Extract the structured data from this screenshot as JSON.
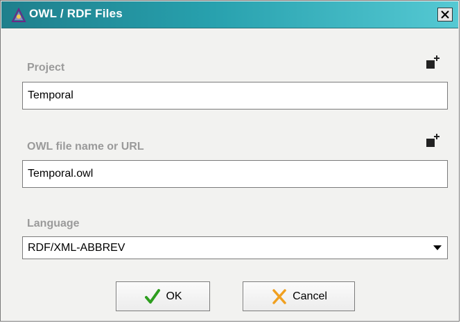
{
  "window": {
    "title": "OWL / RDF Files",
    "close_glyph": "X"
  },
  "project": {
    "label": "Project",
    "value": "Temporal",
    "add_icon": "add-project-icon"
  },
  "owl_file": {
    "label": "OWL file name or URL",
    "value": "Temporal.owl",
    "add_icon": "add-file-icon"
  },
  "language": {
    "label": "Language",
    "selected": "RDF/XML-ABBREV"
  },
  "buttons": {
    "ok": "OK",
    "cancel": "Cancel"
  },
  "colors": {
    "titlebar_start": "#1f7f8c",
    "titlebar_end": "#55c9d3",
    "label_gray": "#9a9a9a",
    "ok_check": "#2e9e1f",
    "cancel_x": "#f0a020"
  }
}
